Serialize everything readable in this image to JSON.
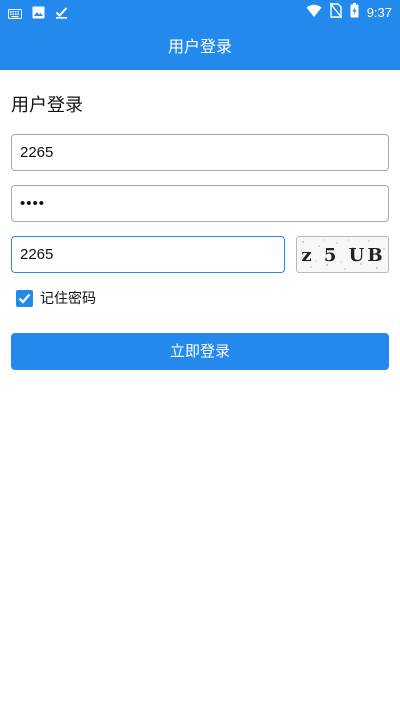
{
  "status_bar": {
    "time": "9:37",
    "icons_left": [
      "keyboard-icon",
      "image-icon",
      "checkmark-icon"
    ],
    "icons_right": [
      "wifi-icon",
      "no-sim-icon",
      "battery-charging-icon"
    ]
  },
  "app_bar": {
    "title": "用户登录",
    "color": "#2489EC"
  },
  "page": {
    "heading": "用户登录"
  },
  "form": {
    "username_value": "2265",
    "password_value": "••••",
    "captcha_input_value": "2265",
    "captcha_image_text": "z 5 UB",
    "remember_label": "记住密码",
    "remember_checked": true,
    "login_label": "立即登录"
  }
}
